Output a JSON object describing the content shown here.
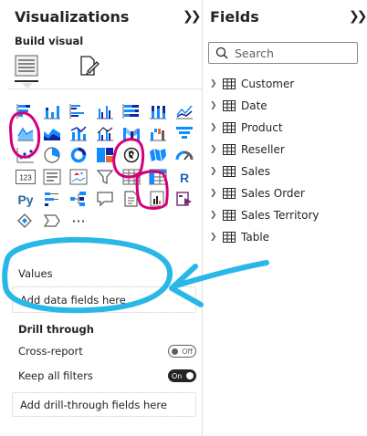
{
  "visualizations": {
    "title": "Visualizations",
    "collapse_icon": "double-chevron-right-icon",
    "build_visual_label": "Build visual",
    "build_tabs": [
      {
        "icon": "build-visual-grid-icon",
        "active": true
      },
      {
        "icon": "format-paintbrush-icon",
        "active": false
      }
    ],
    "visual_icons": [
      [
        "stacked-bar-chart",
        "stacked-column-chart",
        "clustered-bar-chart",
        "clustered-column-chart",
        "100-stacked-bar-chart",
        "100-stacked-column-chart",
        "line-chart"
      ],
      [
        "area-chart",
        "stacked-area-chart",
        "line-and-stacked-column-chart",
        "line-and-clustered-column-chart",
        "ribbon-chart",
        "waterfall-chart",
        "funnel-chart"
      ],
      [
        "scatter-chart",
        "pie-chart",
        "donut-chart",
        "treemap",
        "map",
        "filled-map",
        "gauge"
      ],
      [
        "card",
        "multi-row-card",
        "kpi",
        "slicer",
        "table",
        "matrix",
        "r-script-visual"
      ],
      [
        "python-visual",
        "key-influencers",
        "decomposition-tree",
        "qa-visual",
        "smart-narrative",
        "paginated-report",
        "power-apps"
      ],
      [
        "power-automate",
        "arcgis-map",
        "more-visuals"
      ]
    ],
    "card_text": "123",
    "r_text": "R",
    "py_text": "Py",
    "more_text": "···",
    "values_label": "Values",
    "values_placeholder": "Add data fields here",
    "drill_through_label": "Drill through",
    "cross_report_label": "Cross-report",
    "cross_report_state": "Off",
    "keep_filters_label": "Keep all filters",
    "keep_filters_state": "On",
    "drill_placeholder": "Add drill-through fields here"
  },
  "fields": {
    "title": "Fields",
    "collapse_icon": "double-chevron-right-icon",
    "search_placeholder": "Search",
    "tables": [
      "Customer",
      "Date",
      "Product",
      "Reseller",
      "Sales",
      "Sales Order",
      "Sales Territory",
      "Table"
    ]
  },
  "colors": {
    "accent_blue": "#118dff",
    "accent_dark": "#12239e",
    "accent_orange": "#e66c37",
    "highlight_magenta": "#d3007a",
    "annotation_cyan": "#29b7e8"
  }
}
